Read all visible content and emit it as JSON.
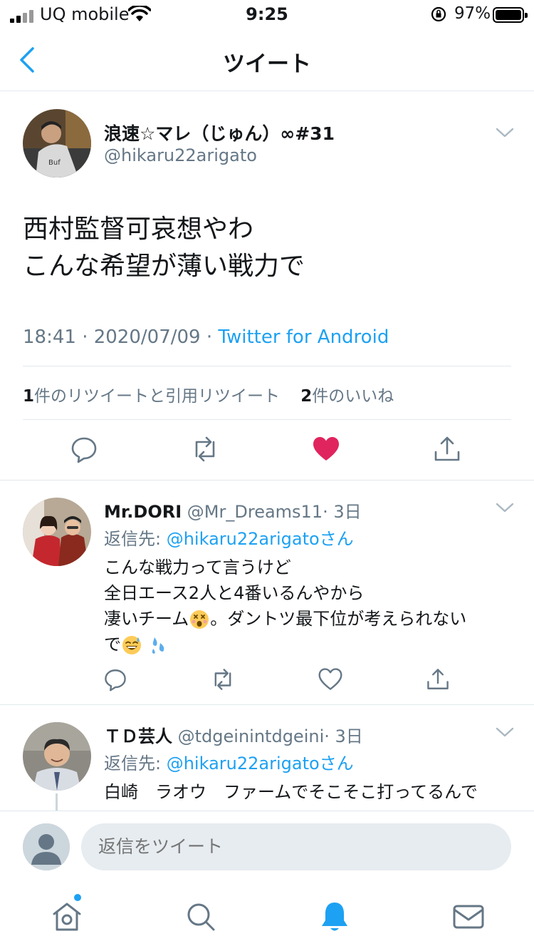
{
  "status_bar": {
    "carrier": "UQ mobile",
    "time": "9:25",
    "battery": "97%"
  },
  "nav": {
    "title": "ツイート"
  },
  "tweet": {
    "display_name": "浪速☆マレ（じゅん）∞#31",
    "handle": "@hikaru22arigato",
    "text_lines": [
      "西村監督可哀想やわ",
      "こんな希望が薄い戦力で"
    ],
    "time": "18:41 · 2020/07/09 · ",
    "source": "Twitter for Android",
    "retweet_count": "1",
    "retweet_label": "件のリツイートと引用リツイート",
    "like_count": "2",
    "like_label": "件のいいね",
    "liked": true
  },
  "replies": [
    {
      "display_name": "Mr.DORI",
      "handle": "@Mr_Dreams11",
      "age": "· 3日",
      "reply_to_label": "返信先: ",
      "reply_to_handle": "@hikaru22arigatoさん",
      "text_lines": [
        "こんな戦力って言うけど",
        "全日エース2人と4番いるんやから",
        "凄いチーム",
        "。ダントツ最下位が考えられない",
        "で"
      ]
    },
    {
      "display_name": "ＴＤ芸人",
      "handle": "@tdgeinintdgeini",
      "age": "· 3日",
      "reply_to_label": "返信先: ",
      "reply_to_handle": "@hikaru22arigatoさん",
      "text_lines": [
        "白崎　ラオウ　ファームでそこそこ打ってるんで"
      ]
    }
  ],
  "compose": {
    "placeholder": "返信をツイート"
  },
  "tabs": [
    "home-icon",
    "search-icon",
    "notifications-icon",
    "messages-icon"
  ],
  "colors": {
    "accent": "#1da1f2",
    "like": "#e0245e",
    "muted": "#657786",
    "border": "#e1e8ed"
  }
}
